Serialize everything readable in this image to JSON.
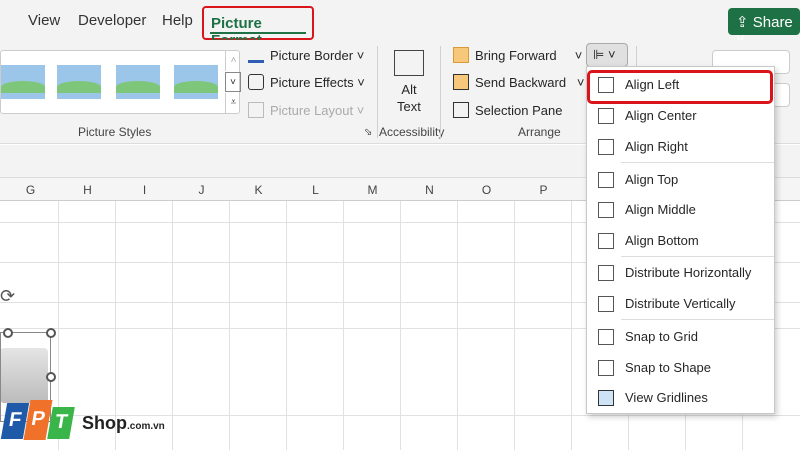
{
  "tabs": [
    "View",
    "Developer",
    "Help",
    "Picture Format"
  ],
  "share": "Share",
  "ribbon": {
    "picture_border": "Picture Border",
    "picture_effects": "Picture Effects",
    "picture_layout": "Picture Layout",
    "picture_styles": "Picture Styles",
    "alt_text_1": "Alt",
    "alt_text_2": "Text",
    "accessibility": "Accessibility",
    "bring_forward": "Bring Forward",
    "send_backward": "Send Backward",
    "selection_pane": "Selection Pane",
    "arrange": "Arrange"
  },
  "columns": [
    "G",
    "H",
    "I",
    "J",
    "K",
    "L",
    "M",
    "N",
    "O",
    "P"
  ],
  "menu": [
    "Align Left",
    "Align Center",
    "Align Right",
    "Align Top",
    "Align Middle",
    "Align Bottom",
    "Distribute Horizontally",
    "Distribute Vertically",
    "Snap to Grid",
    "Snap to Shape",
    "View Gridlines"
  ],
  "logo": {
    "brand": "FPT",
    "shop": "Shop",
    "domain": ".com.vn"
  }
}
